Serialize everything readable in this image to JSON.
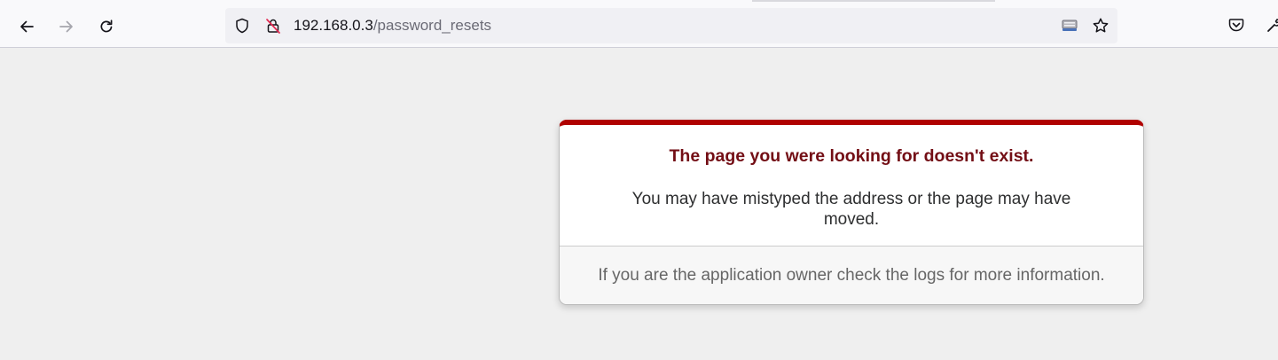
{
  "browser": {
    "url_host": "192.168.0.3",
    "url_path": "/password_resets",
    "icons": {
      "back": "arrow-left-icon",
      "forward": "arrow-right-icon",
      "reload": "reload-icon",
      "tracking_protection": "shield-icon",
      "connection": "insecure-lock-icon",
      "reader_view": "page-icon",
      "bookmark": "star-icon",
      "pocket": "pocket-icon",
      "extensions": "wrench-icon"
    },
    "colors": {
      "toolbar": "#f9f9fb",
      "urlbar": "#f0f0f4",
      "insecure": "#e22850"
    }
  },
  "error_page": {
    "title": "The page you were looking for doesn't exist.",
    "message": "You may have mistyped the address or the page may have moved.",
    "footer": "If you are the application owner check the logs for more information.",
    "colors": {
      "accent": "#b00100",
      "title": "#730e15",
      "background": "#efefef"
    }
  }
}
